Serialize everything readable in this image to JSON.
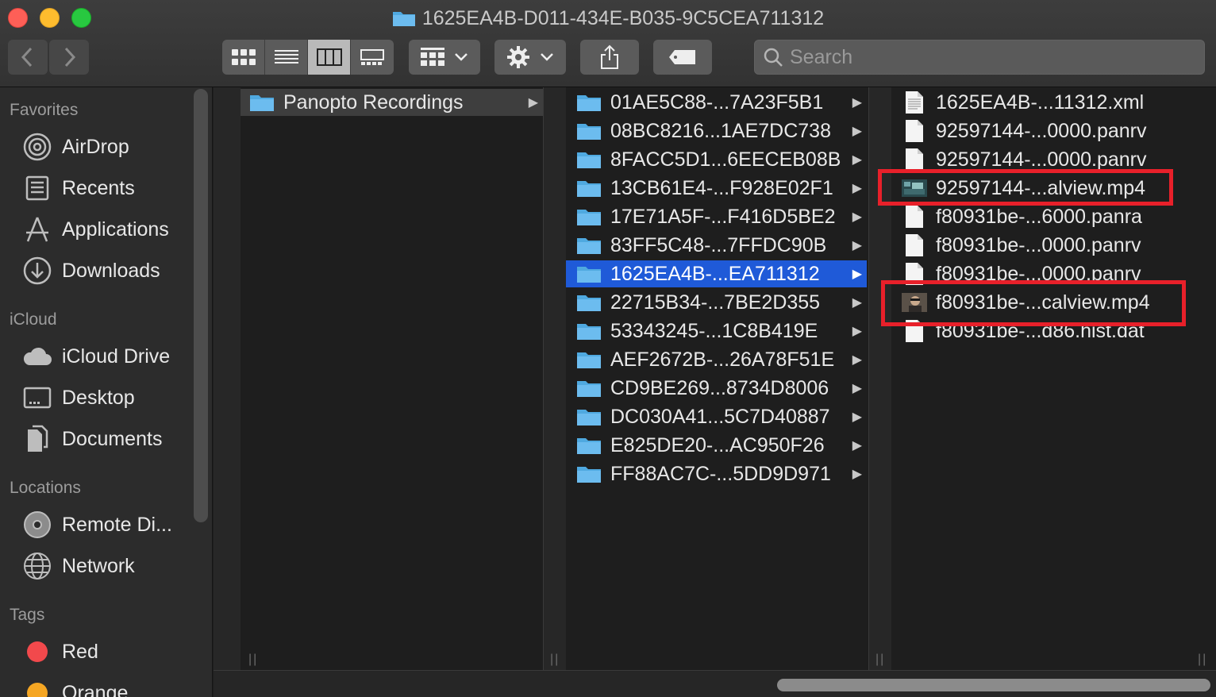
{
  "window": {
    "title": "1625EA4B-D011-434E-B035-9C5CEA711312"
  },
  "toolbar": {
    "back_icon": "chevron-left-icon",
    "forward_icon": "chevron-right-icon",
    "view_modes": [
      "icon-view",
      "list-view",
      "column-view",
      "gallery-view"
    ],
    "active_view": "column-view",
    "search_placeholder": "Search"
  },
  "sidebar": {
    "sections": [
      {
        "heading": "Favorites",
        "items": [
          {
            "label": "AirDrop",
            "icon": "airdrop-icon"
          },
          {
            "label": "Recents",
            "icon": "recents-icon"
          },
          {
            "label": "Applications",
            "icon": "applications-icon"
          },
          {
            "label": "Downloads",
            "icon": "downloads-icon"
          }
        ]
      },
      {
        "heading": "iCloud",
        "items": [
          {
            "label": "iCloud Drive",
            "icon": "cloud-icon"
          },
          {
            "label": "Desktop",
            "icon": "desktop-icon"
          },
          {
            "label": "Documents",
            "icon": "documents-icon"
          }
        ]
      },
      {
        "heading": "Locations",
        "items": [
          {
            "label": "Remote Di...",
            "icon": "disc-icon"
          },
          {
            "label": "Network",
            "icon": "network-icon"
          }
        ]
      },
      {
        "heading": "Tags",
        "items": [
          {
            "label": "Red",
            "color": "#f2494c"
          },
          {
            "label": "Orange",
            "color": "#f5a623"
          }
        ]
      }
    ]
  },
  "columns": [
    {
      "items": [
        {
          "name": "Panopto Recordings",
          "type": "folder",
          "state": "parent"
        }
      ]
    },
    {
      "items": [
        {
          "name": "01AE5C88-...7A23F5B1",
          "type": "folder"
        },
        {
          "name": "08BC8216...1AE7DC738",
          "type": "folder"
        },
        {
          "name": "8FACC5D1...6EECEB08B",
          "type": "folder"
        },
        {
          "name": "13CB61E4-...F928E02F1",
          "type": "folder"
        },
        {
          "name": "17E71A5F-...F416D5BE2",
          "type": "folder"
        },
        {
          "name": "83FF5C48-...7FFDC90B",
          "type": "folder"
        },
        {
          "name": "1625EA4B-...EA711312",
          "type": "folder",
          "state": "selected"
        },
        {
          "name": "22715B34-...7BE2D355",
          "type": "folder"
        },
        {
          "name": "53343245-...1C8B419E",
          "type": "folder"
        },
        {
          "name": "AEF2672B-...26A78F51E",
          "type": "folder"
        },
        {
          "name": "CD9BE269...8734D8006",
          "type": "folder"
        },
        {
          "name": "DC030A41...5C7D40887",
          "type": "folder"
        },
        {
          "name": "E825DE20-...AC950F26",
          "type": "folder"
        },
        {
          "name": "FF88AC7C-...5DD9D971",
          "type": "folder"
        }
      ]
    },
    {
      "items": [
        {
          "name": "1625EA4B-...11312.xml",
          "type": "xml"
        },
        {
          "name": "92597144-...0000.panrv",
          "type": "file"
        },
        {
          "name": "92597144-...0000.panrv",
          "type": "file"
        },
        {
          "name": "92597144-...alview.mp4",
          "type": "video",
          "highlighted": true
        },
        {
          "name": "f80931be-...6000.panra",
          "type": "file"
        },
        {
          "name": "f80931be-...0000.panrv",
          "type": "file"
        },
        {
          "name": "f80931be-...0000.panrv",
          "type": "file"
        },
        {
          "name": "f80931be-...calview.mp4",
          "type": "video2",
          "highlighted": true
        },
        {
          "name": "f80931be-...d86.hist.dat",
          "type": "file"
        }
      ]
    }
  ],
  "colors": {
    "selection": "#1f5ad8",
    "highlight_box": "#e8202a",
    "folder": "#4fa9e0"
  }
}
